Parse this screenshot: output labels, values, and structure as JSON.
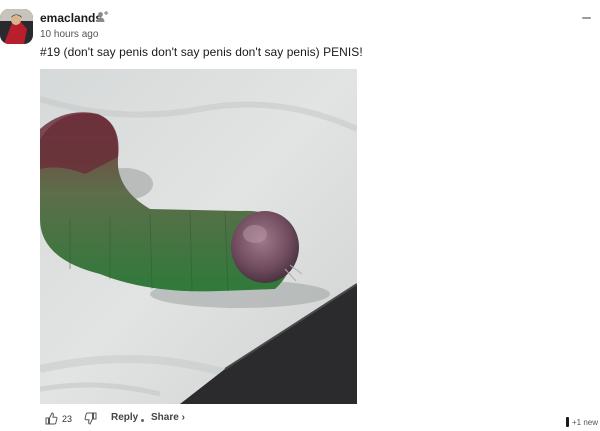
{
  "comment": {
    "username": "emaclands",
    "timestamp": "10 hours ago",
    "text": "#19 (don't say penis don't say penis don't say penis) PENIS!",
    "vote_count": "23",
    "reply_label": "Reply",
    "share_label": "Share ›"
  },
  "footer": {
    "new_indicator": "+1 new"
  },
  "icons": {
    "follow": "add-user-icon",
    "collapse": "minus-icon",
    "upvote": "thumbs-up-icon",
    "downvote": "thumbs-down-icon"
  }
}
